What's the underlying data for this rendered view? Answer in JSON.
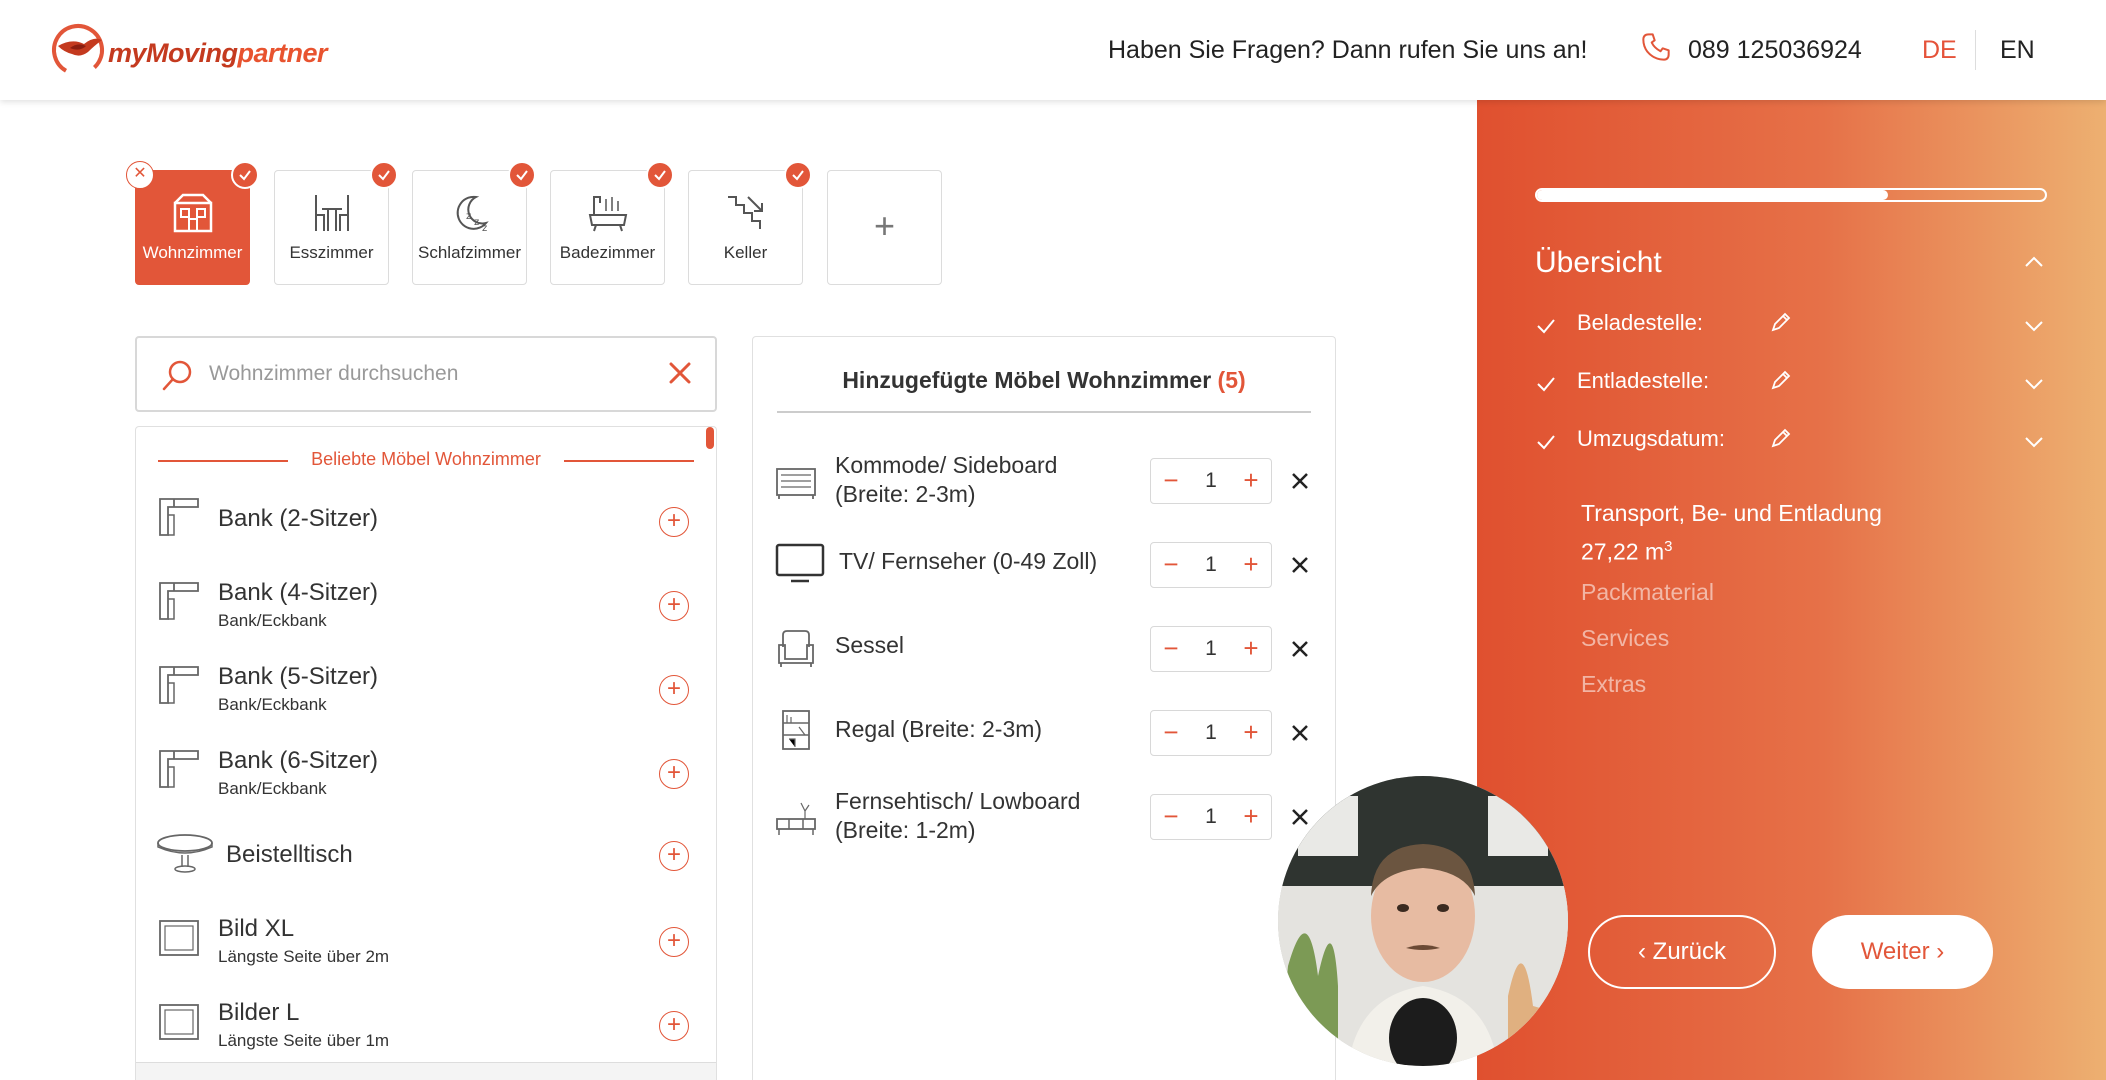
{
  "header": {
    "logo_part1": "myMoving",
    "logo_part2": "partner",
    "help_text": "Haben Sie Fragen? Dann rufen Sie uns an!",
    "phone": "089 125036924",
    "lang_de": "DE",
    "lang_en": "EN"
  },
  "rooms": [
    {
      "label": "Wohnzimmer",
      "icon": "living-room-icon",
      "active": true
    },
    {
      "label": "Esszimmer",
      "icon": "dining-room-icon"
    },
    {
      "label": "Schlafzimmer",
      "icon": "bedroom-icon"
    },
    {
      "label": "Badezimmer",
      "icon": "bathroom-icon"
    },
    {
      "label": "Keller",
      "icon": "basement-icon"
    }
  ],
  "add_room_label": "+",
  "search": {
    "placeholder": "Wohnzimmer durchsuchen"
  },
  "list": {
    "heading": "Beliebte Möbel Wohnzimmer",
    "items": [
      {
        "name": "Bank (2-Sitzer)",
        "sub": "",
        "icon": "corner-bench-icon"
      },
      {
        "name": "Bank (4-Sitzer)",
        "sub": "Bank/Eckbank",
        "icon": "corner-bench-icon"
      },
      {
        "name": "Bank (5-Sitzer)",
        "sub": "Bank/Eckbank",
        "icon": "corner-bench-icon"
      },
      {
        "name": "Bank (6-Sitzer)",
        "sub": "Bank/Eckbank",
        "icon": "corner-bench-icon"
      },
      {
        "name": "Beistelltisch",
        "sub": "",
        "icon": "side-table-icon"
      },
      {
        "name": "Bild XL",
        "sub": "Längste Seite über 2m",
        "icon": "picture-frame-icon"
      },
      {
        "name": "Bilder L",
        "sub": "Längste Seite über 1m",
        "icon": "picture-frame-icon"
      }
    ]
  },
  "added": {
    "title": "Hinzugefügte Möbel Wohnzimmer",
    "count": "(5)",
    "items": [
      {
        "name": "Kommode/ Sideboard (Breite: 2-3m)",
        "qty": "1",
        "icon": "sideboard-icon"
      },
      {
        "name": "TV/ Fernseher (0-49 Zoll)",
        "qty": "1",
        "icon": "tv-icon"
      },
      {
        "name": "Sessel",
        "qty": "1",
        "icon": "armchair-icon"
      },
      {
        "name": "Regal (Breite: 2-3m)",
        "qty": "1",
        "icon": "shelf-icon"
      },
      {
        "name": "Fernsehtisch/ Lowboard (Breite: 1-2m)",
        "qty": "1",
        "icon": "lowboard-icon"
      }
    ],
    "minus": "−",
    "plus": "+"
  },
  "overview": {
    "progress_fraction": 0.69,
    "title": "Übersicht",
    "rows": [
      {
        "label": "Beladestelle:"
      },
      {
        "label": "Entladestelle:"
      },
      {
        "label": "Umzugsdatum:"
      }
    ],
    "summary_line1": "Transport, Be- und Entladung",
    "volume": "27,22 m",
    "volume_sup": "3",
    "muted": [
      "Packmaterial",
      "Services",
      "Extras"
    ],
    "back": "Zurück",
    "next": "Weiter"
  },
  "colors": {
    "accent": "#e25639",
    "panel_start": "#e0502f",
    "panel_end": "#edb071"
  }
}
